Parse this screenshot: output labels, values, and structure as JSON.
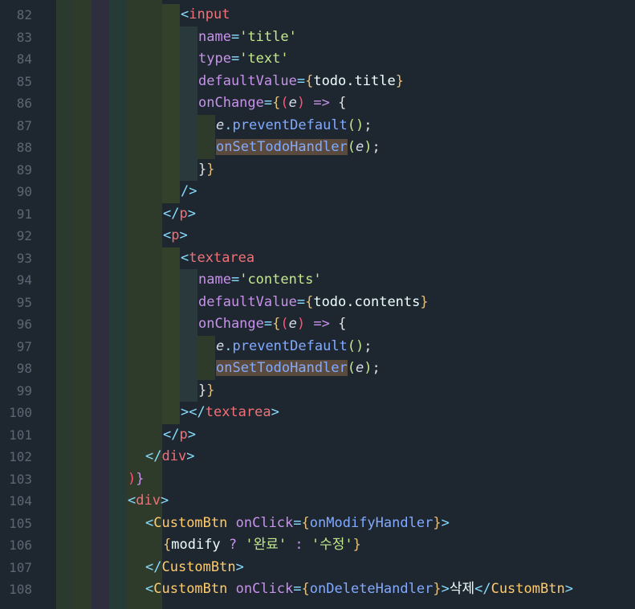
{
  "editor": {
    "lines": [
      {
        "n": "82"
      },
      {
        "n": "83"
      },
      {
        "n": "84"
      },
      {
        "n": "85"
      },
      {
        "n": "86"
      },
      {
        "n": "87"
      },
      {
        "n": "88"
      },
      {
        "n": "89"
      },
      {
        "n": "90"
      },
      {
        "n": "91"
      },
      {
        "n": "92"
      },
      {
        "n": "93"
      },
      {
        "n": "94"
      },
      {
        "n": "95"
      },
      {
        "n": "96"
      },
      {
        "n": "97"
      },
      {
        "n": "98"
      },
      {
        "n": "99"
      },
      {
        "n": "100"
      },
      {
        "n": "101"
      },
      {
        "n": "102"
      },
      {
        "n": "103"
      },
      {
        "n": "104"
      },
      {
        "n": "105"
      },
      {
        "n": "106"
      },
      {
        "n": "107"
      },
      {
        "n": "108"
      }
    ],
    "tokens": {
      "input": "input",
      "name": "name",
      "type": "type",
      "title_str": "'title'",
      "text_str": "'text'",
      "defaultValue": "defaultValue",
      "todo_title": "todo.title",
      "todo_contents": "todo.contents",
      "onChange": "onChange",
      "e": "e",
      "preventDefault": "preventDefault",
      "onSetTodoHandler": "onSetTodoHandler",
      "p": "p",
      "textarea": "textarea",
      "contents_str": "'contents'",
      "div": "div",
      "CustomBtn": "CustomBtn",
      "onClick": "onClick",
      "onModifyHandler": "onModifyHandler",
      "onDeleteHandler": "onDeleteHandler",
      "modify": "modify",
      "done_str": "'완료'",
      "edit_str": "'수정'",
      "delete_text": "삭제"
    },
    "colors": {
      "background": "#1e2630",
      "tag": "#f07178",
      "punct": "#89ddff",
      "attr": "#c792ea",
      "string": "#c3e88d",
      "brace": "#e5c07b",
      "function": "#82aaff",
      "component": "#ffcb6b",
      "highlight": "#5a4a3e"
    }
  }
}
